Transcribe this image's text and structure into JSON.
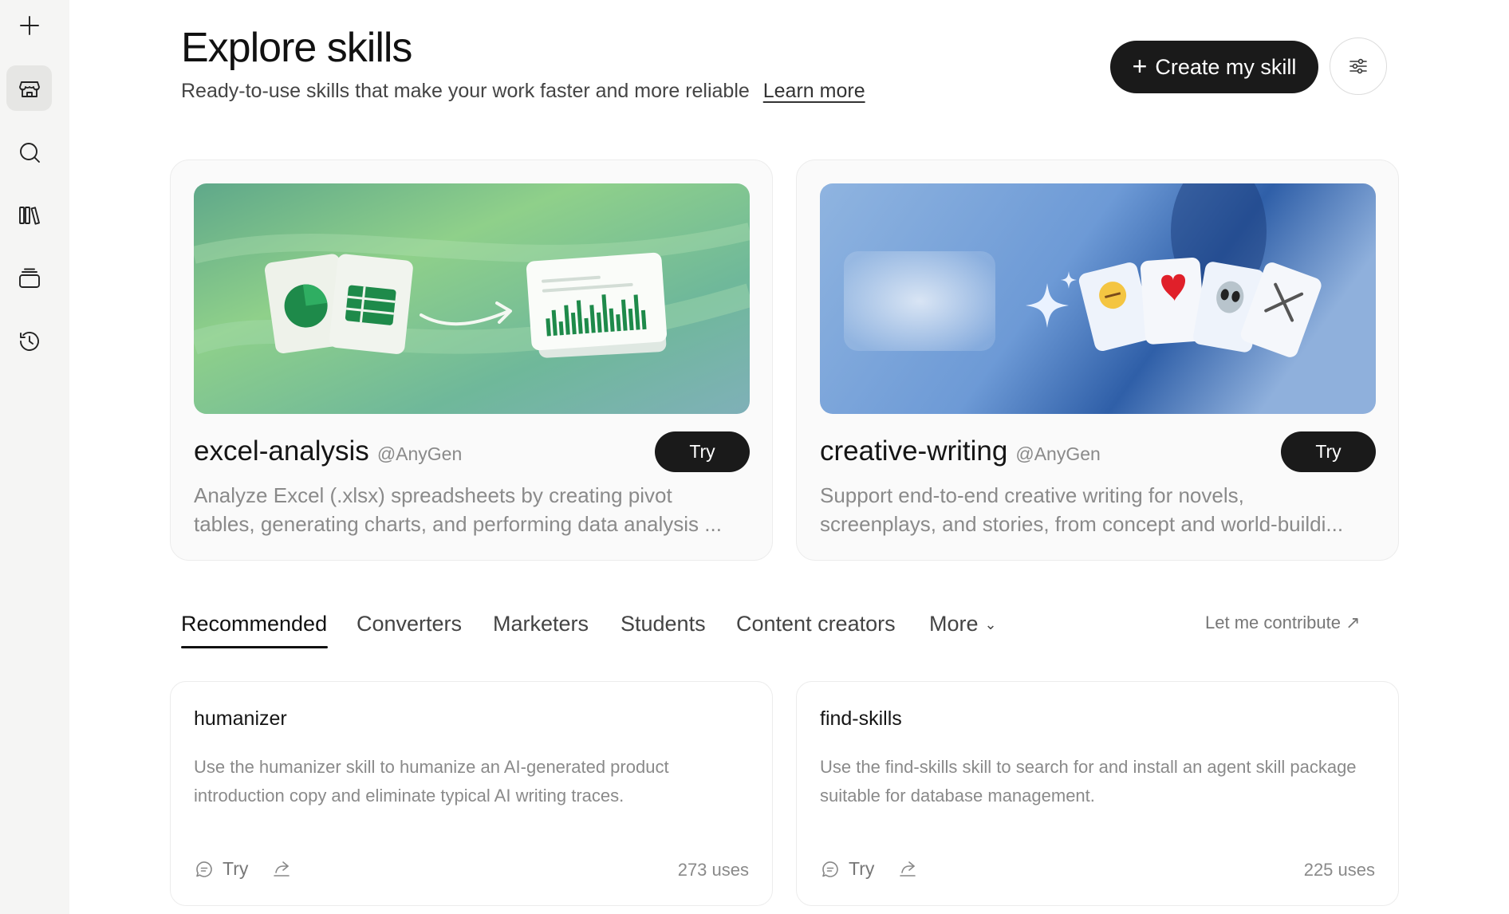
{
  "sidebar": {
    "items": [
      {
        "name": "new",
        "icon": "plus-icon"
      },
      {
        "name": "skills-store",
        "icon": "store-icon",
        "active": true
      },
      {
        "name": "search",
        "icon": "search-icon"
      },
      {
        "name": "library",
        "icon": "library-icon"
      },
      {
        "name": "projects",
        "icon": "stack-icon"
      },
      {
        "name": "history",
        "icon": "history-icon"
      }
    ]
  },
  "header": {
    "title": "Explore skills",
    "subtitle": "Ready-to-use skills that make your work faster and more reliable",
    "learn_more": "Learn more",
    "create_button": "Create my skill",
    "create_icon": "+",
    "filter_icon": "sliders-icon"
  },
  "featured": [
    {
      "name": "excel-analysis",
      "author": "@AnyGen",
      "try_label": "Try",
      "desc_line1": "Analyze Excel (.xlsx) spreadsheets by creating pivot",
      "desc_line2": "tables, generating charts, and performing data analysis ..."
    },
    {
      "name": "creative-writing",
      "author": "@AnyGen",
      "try_label": "Try",
      "desc_line1": "Support end-to-end creative writing for novels,",
      "desc_line2": "screenplays, and stories, from concept and world-buildi..."
    }
  ],
  "tabs": {
    "items": [
      "Recommended",
      "Converters",
      "Marketers",
      "Students",
      "Content creators",
      "More"
    ],
    "active": "Recommended",
    "contribute": "Let me contribute ↗"
  },
  "skills": [
    {
      "name": "humanizer",
      "description": "Use the humanizer skill to humanize an AI-generated product introduction copy and eliminate typical AI writing traces.",
      "try_label": "Try",
      "uses": "273 uses"
    },
    {
      "name": "find-skills",
      "description": "Use the find-skills skill to search for and install an agent skill package suitable for database management.",
      "try_label": "Try",
      "uses": "225 uses"
    }
  ],
  "colors": {
    "accent_dark": "#1a1a1a",
    "sidebar_bg": "#f5f5f4",
    "muted_text": "#8a8a8a",
    "excel_green": "#1e8a4a",
    "creative_blue": "#3a6fb8"
  }
}
